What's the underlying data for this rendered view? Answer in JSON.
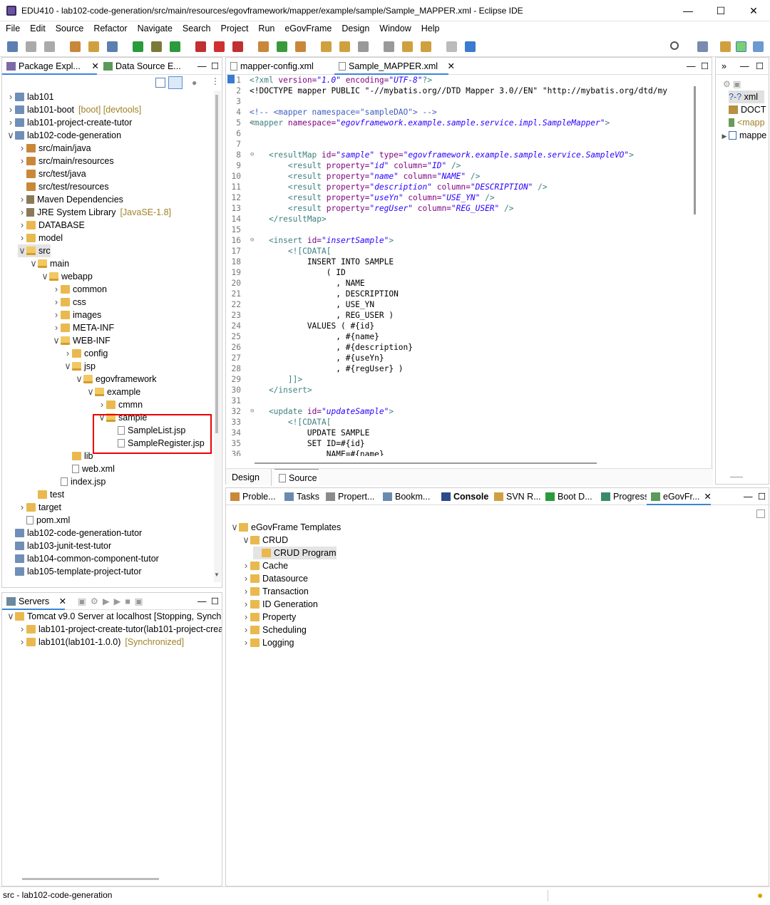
{
  "window": {
    "title": "EDU410 - lab102-code-generation/src/main/resources/egovframework/mapper/example/sample/Sample_MAPPER.xml - Eclipse IDE"
  },
  "menu": [
    "File",
    "Edit",
    "Source",
    "Refactor",
    "Navigate",
    "Search",
    "Project",
    "Run",
    "eGovFrame",
    "Design",
    "Window",
    "Help"
  ],
  "explorer": {
    "tabs": [
      "Package Expl...",
      "Data Source E..."
    ],
    "tree": [
      {
        "d": 0,
        "t": "lab101",
        "i": "proj",
        "tw": ">"
      },
      {
        "d": 0,
        "t": "lab101-boot",
        "x": "[boot] [devtools]",
        "i": "proj",
        "tw": ">"
      },
      {
        "d": 0,
        "t": "lab101-project-create-tutor",
        "i": "proj",
        "tw": ">"
      },
      {
        "d": 0,
        "t": "lab102-code-generation",
        "i": "proj",
        "tw": "v"
      },
      {
        "d": 1,
        "t": "src/main/java",
        "i": "pkg",
        "tw": ">"
      },
      {
        "d": 1,
        "t": "src/main/resources",
        "i": "pkg",
        "tw": ">"
      },
      {
        "d": 1,
        "t": "src/test/java",
        "i": "pkg",
        "tw": ""
      },
      {
        "d": 1,
        "t": "src/test/resources",
        "i": "pkg",
        "tw": ""
      },
      {
        "d": 1,
        "t": "Maven Dependencies",
        "i": "lib",
        "tw": ">"
      },
      {
        "d": 1,
        "t": "JRE System Library",
        "x": "[JavaSE-1.8]",
        "i": "lib",
        "tw": ">"
      },
      {
        "d": 1,
        "t": "DATABASE",
        "i": "folder",
        "tw": ">"
      },
      {
        "d": 1,
        "t": "model",
        "i": "folder",
        "tw": ">"
      },
      {
        "d": 1,
        "t": "src",
        "i": "folder-open",
        "tw": "v",
        "sel": true
      },
      {
        "d": 2,
        "t": "main",
        "i": "folder-open",
        "tw": "v"
      },
      {
        "d": 3,
        "t": "webapp",
        "i": "folder-open",
        "tw": "v"
      },
      {
        "d": 4,
        "t": "common",
        "i": "folder",
        "tw": ">"
      },
      {
        "d": 4,
        "t": "css",
        "i": "folder",
        "tw": ">"
      },
      {
        "d": 4,
        "t": "images",
        "i": "folder",
        "tw": ">"
      },
      {
        "d": 4,
        "t": "META-INF",
        "i": "folder",
        "tw": ">"
      },
      {
        "d": 4,
        "t": "WEB-INF",
        "i": "folder-open",
        "tw": "v"
      },
      {
        "d": 5,
        "t": "config",
        "i": "folder",
        "tw": ">"
      },
      {
        "d": 5,
        "t": "jsp",
        "i": "folder-open",
        "tw": "v"
      },
      {
        "d": 6,
        "t": "egovframework",
        "i": "folder-open",
        "tw": "v"
      },
      {
        "d": 7,
        "t": "example",
        "i": "folder-open",
        "tw": "v"
      },
      {
        "d": 8,
        "t": "cmmn",
        "i": "folder",
        "tw": ">"
      },
      {
        "d": 8,
        "t": "sample",
        "i": "folder-open",
        "tw": "v"
      },
      {
        "d": 9,
        "t": "SampleList.jsp",
        "i": "file",
        "tw": ""
      },
      {
        "d": 9,
        "t": "SampleRegister.jsp",
        "i": "file",
        "tw": ""
      },
      {
        "d": 5,
        "t": "lib",
        "i": "folder",
        "tw": ""
      },
      {
        "d": 5,
        "t": "web.xml",
        "i": "file",
        "tw": ""
      },
      {
        "d": 4,
        "t": "index.jsp",
        "i": "file",
        "tw": ""
      },
      {
        "d": 2,
        "t": "test",
        "i": "folder",
        "tw": ""
      },
      {
        "d": 1,
        "t": "target",
        "i": "folder",
        "tw": ">"
      },
      {
        "d": 1,
        "t": "pom.xml",
        "i": "file",
        "tw": ""
      },
      {
        "d": 0,
        "t": "lab102-code-generation-tutor",
        "i": "proj",
        "tw": ""
      },
      {
        "d": 0,
        "t": "lab103-junit-test-tutor",
        "i": "proj",
        "tw": ""
      },
      {
        "d": 0,
        "t": "lab104-common-component-tutor",
        "i": "proj",
        "tw": ""
      },
      {
        "d": 0,
        "t": "lab105-template-project-tutor",
        "i": "proj",
        "tw": ""
      }
    ]
  },
  "servers": {
    "tab": "Servers",
    "rows": [
      {
        "t": "Tomcat v9.0 Server at localhost  [Stopping, Synch",
        "d": 0,
        "tw": "v"
      },
      {
        "t": "lab101-project-create-tutor(lab101-project-crea",
        "d": 1,
        "tw": ">"
      },
      {
        "t": "lab101(lab101-1.0.0)",
        "x": "[Synchronized]",
        "d": 1,
        "tw": ">"
      }
    ]
  },
  "editor": {
    "tabs": [
      "mapper-config.xml",
      "Sample_MAPPER.xml"
    ],
    "lines": [
      [
        [
          "<?xml ",
          "t"
        ],
        [
          "version=",
          "a"
        ],
        [
          "\"1.0\"",
          "v"
        ],
        [
          " encoding=",
          "a"
        ],
        [
          "\"UTF-8\"",
          "v"
        ],
        [
          "?>",
          "t"
        ]
      ],
      [
        [
          "<!DOCTYPE mapper PUBLIC \"-//mybatis.org//DTD Mapper 3.0//EN\" \"http://mybatis.org/dtd/my",
          "p"
        ]
      ],
      [
        [
          "",
          "p"
        ]
      ],
      [
        [
          "<!-- <mapper namespace=\"sampleDAO\"> -->",
          "c"
        ]
      ],
      [
        [
          "<mapper ",
          "t"
        ],
        [
          "namespace=",
          "a"
        ],
        [
          "\"egovframework.example.sample.service.impl.SampleMapper\"",
          "v"
        ],
        [
          ">",
          "t"
        ]
      ],
      [
        [
          "",
          "p"
        ]
      ],
      [
        [
          "",
          "p"
        ]
      ],
      [
        [
          "    <resultMap ",
          "t"
        ],
        [
          "id=",
          "a"
        ],
        [
          "\"sample\"",
          "v"
        ],
        [
          " type=",
          "a"
        ],
        [
          "\"egovframework.example.sample.service.SampleVO\"",
          "v"
        ],
        [
          ">",
          "t"
        ]
      ],
      [
        [
          "        <result ",
          "t"
        ],
        [
          "property=",
          "a"
        ],
        [
          "\"id\"",
          "v"
        ],
        [
          " column=",
          "a"
        ],
        [
          "\"ID\"",
          "v"
        ],
        [
          " />",
          "t"
        ]
      ],
      [
        [
          "        <result ",
          "t"
        ],
        [
          "property=",
          "a"
        ],
        [
          "\"name\"",
          "v"
        ],
        [
          " column=",
          "a"
        ],
        [
          "\"NAME\"",
          "v"
        ],
        [
          " />",
          "t"
        ]
      ],
      [
        [
          "        <result ",
          "t"
        ],
        [
          "property=",
          "a"
        ],
        [
          "\"description\"",
          "v"
        ],
        [
          " column=",
          "a"
        ],
        [
          "\"DESCRIPTION\"",
          "v"
        ],
        [
          " />",
          "t"
        ]
      ],
      [
        [
          "        <result ",
          "t"
        ],
        [
          "property=",
          "a"
        ],
        [
          "\"useYn\"",
          "v"
        ],
        [
          " column=",
          "a"
        ],
        [
          "\"USE_YN\"",
          "v"
        ],
        [
          " />",
          "t"
        ]
      ],
      [
        [
          "        <result ",
          "t"
        ],
        [
          "property=",
          "a"
        ],
        [
          "\"regUser\"",
          "v"
        ],
        [
          " column=",
          "a"
        ],
        [
          "\"REG_USER\"",
          "v"
        ],
        [
          " />",
          "t"
        ]
      ],
      [
        [
          "    </resultMap>",
          "t"
        ]
      ],
      [
        [
          "",
          "p"
        ]
      ],
      [
        [
          "    <insert ",
          "t"
        ],
        [
          "id=",
          "a"
        ],
        [
          "\"insertSample\"",
          "v"
        ],
        [
          ">",
          "t"
        ]
      ],
      [
        [
          "        <![CDATA[",
          "t"
        ]
      ],
      [
        [
          "            INSERT INTO SAMPLE",
          "p"
        ]
      ],
      [
        [
          "                ( ID",
          "p"
        ]
      ],
      [
        [
          "                  , NAME",
          "p"
        ]
      ],
      [
        [
          "                  , DESCRIPTION",
          "p"
        ]
      ],
      [
        [
          "                  , USE_YN",
          "p"
        ]
      ],
      [
        [
          "                  , REG_USER )",
          "p"
        ]
      ],
      [
        [
          "            VALUES ( #{id}",
          "p"
        ]
      ],
      [
        [
          "                  , #{name}",
          "p"
        ]
      ],
      [
        [
          "                  , #{description}",
          "p"
        ]
      ],
      [
        [
          "                  , #{useYn}",
          "p"
        ]
      ],
      [
        [
          "                  , #{regUser} )",
          "p"
        ]
      ],
      [
        [
          "        ]]>",
          "t"
        ]
      ],
      [
        [
          "    </insert>",
          "t"
        ]
      ],
      [
        [
          "",
          "p"
        ]
      ],
      [
        [
          "    <update ",
          "t"
        ],
        [
          "id=",
          "a"
        ],
        [
          "\"updateSample\"",
          "v"
        ],
        [
          ">",
          "t"
        ]
      ],
      [
        [
          "        <![CDATA[",
          "t"
        ]
      ],
      [
        [
          "            UPDATE SAMPLE",
          "p"
        ]
      ],
      [
        [
          "            SET ID=#{id}",
          "p"
        ]
      ],
      [
        [
          "                NAME=#{name}",
          "p"
        ]
      ]
    ],
    "fold": [
      5,
      8,
      16,
      32
    ],
    "bottomtabs": [
      "Design",
      "Source"
    ]
  },
  "outline": {
    "items": [
      "xml",
      "DOCT",
      "<mapp",
      "mappe"
    ]
  },
  "bottom": {
    "tabs": [
      "Proble...",
      "Tasks",
      "Propert...",
      "Bookm...",
      "Console",
      "SVN R...",
      "Boot D...",
      "Progress",
      "eGovFr..."
    ],
    "tree": [
      {
        "t": "eGovFrame Templates",
        "d": 0,
        "tw": "v"
      },
      {
        "t": "CRUD",
        "d": 1,
        "tw": "v"
      },
      {
        "t": "CRUD Program",
        "d": 2,
        "tw": "",
        "sel": true
      },
      {
        "t": "Cache",
        "d": 1,
        "tw": ">"
      },
      {
        "t": "Datasource",
        "d": 1,
        "tw": ">"
      },
      {
        "t": "Transaction",
        "d": 1,
        "tw": ">"
      },
      {
        "t": "ID Generation",
        "d": 1,
        "tw": ">"
      },
      {
        "t": "Property",
        "d": 1,
        "tw": ">"
      },
      {
        "t": "Scheduling",
        "d": 1,
        "tw": ">"
      },
      {
        "t": "Logging",
        "d": 1,
        "tw": ">"
      }
    ]
  },
  "status": {
    "text": "src - lab102-code-generation"
  }
}
